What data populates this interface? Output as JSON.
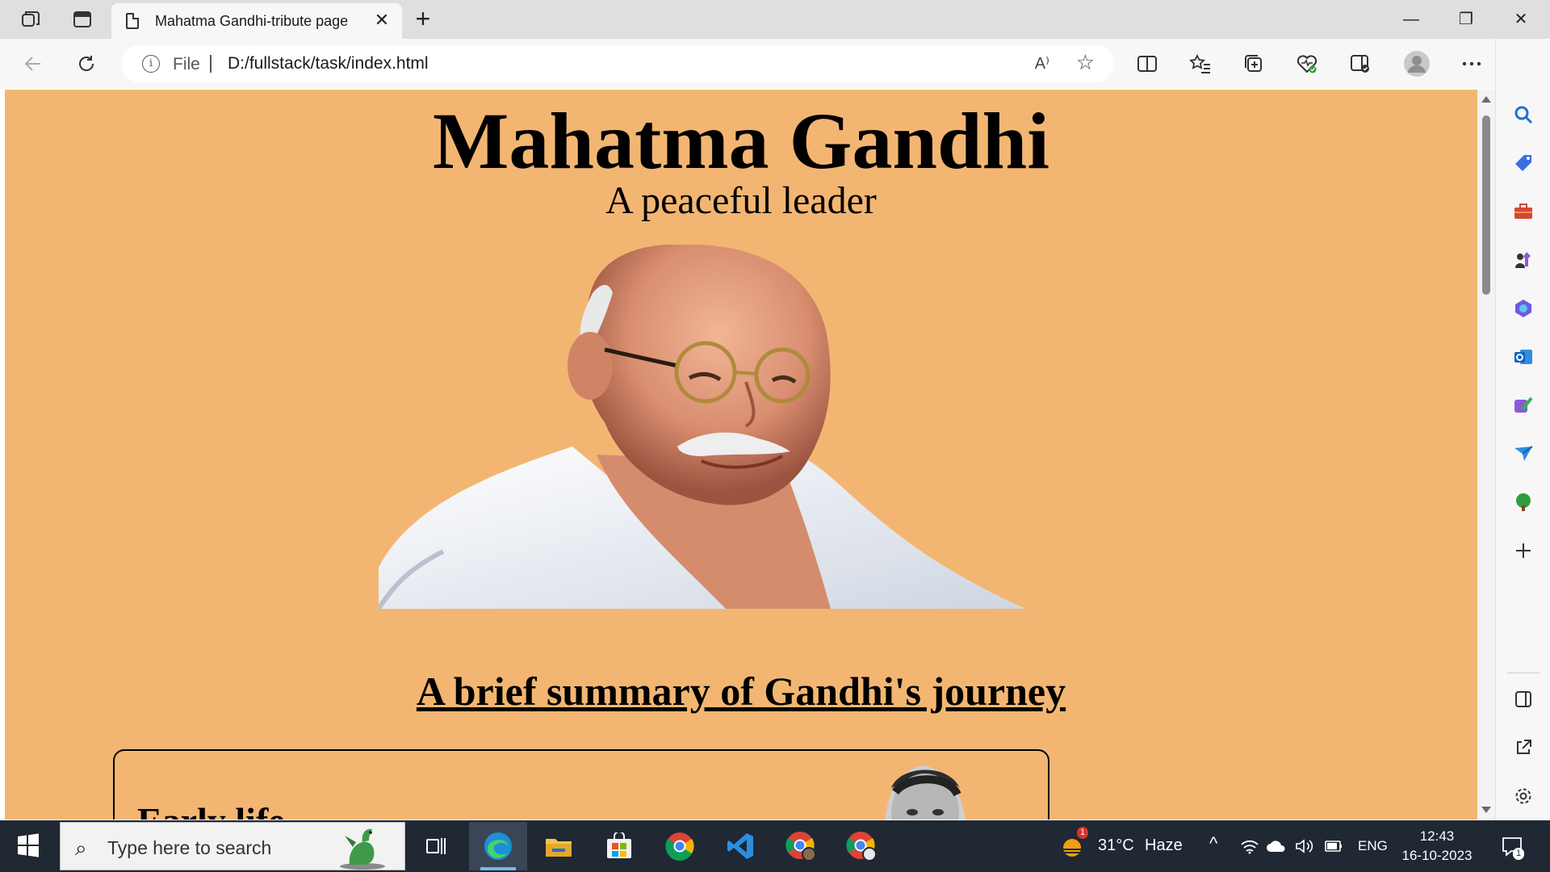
{
  "browser": {
    "tab_title": "Mahatma Gandhi-tribute page",
    "close_glyph": "✕",
    "newtab_glyph": "+",
    "window": {
      "minimize": "—",
      "restore": "❐",
      "close": "✕"
    },
    "address": {
      "scheme_label": "File",
      "url": "D:/fullstack/task/index.html",
      "read_aloud": "A⁾"
    },
    "icons": [
      "workspaces-icon",
      "tab-actions-icon",
      "back-icon",
      "refresh-icon",
      "split-screen-icon",
      "favorites-icon",
      "collections-icon",
      "browser-essentials-icon",
      "copilot-icon",
      "profile-icon",
      "more-icon",
      "bing-icon"
    ]
  },
  "page": {
    "title": "Mahatma Gandhi",
    "subtitle": "A peaceful leader",
    "section_title": "A brief summary of Gandhi's journey",
    "card_heading": "Early life",
    "background_color": "#f3b672"
  },
  "sidebar": {
    "items": [
      "search-icon",
      "shopping-tag-icon",
      "tools-icon",
      "games-icon",
      "microsoft365-icon",
      "outlook-icon",
      "designer-icon",
      "send-icon",
      "tree-icon",
      "add-icon",
      "hide-sidebar-icon",
      "open-external-icon",
      "settings-icon"
    ]
  },
  "taskbar": {
    "search_placeholder": "Type here to search",
    "apps": [
      "task-view-icon",
      "edge-icon",
      "file-explorer-icon",
      "store-icon",
      "chrome-icon",
      "vscode-icon",
      "chrome-profile-icon",
      "chrome-profile-2-icon"
    ],
    "weather": {
      "temp": "31°C",
      "condition": "Haze",
      "badge": "1"
    },
    "language": "ENG",
    "time": "12:43",
    "date": "16-10-2023",
    "notification_count": "1"
  }
}
